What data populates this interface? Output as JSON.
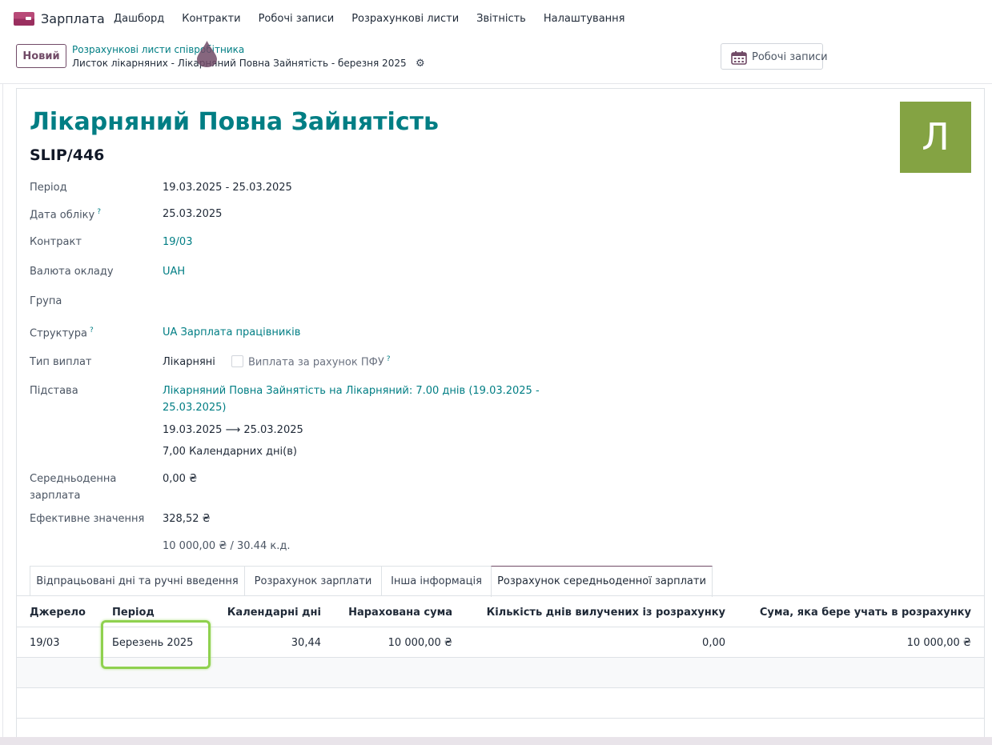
{
  "app": {
    "name": "Зарплата"
  },
  "menu": [
    "Дашборд",
    "Контракти",
    "Робочі записи",
    "Розрахункові листи",
    "Звітність",
    "Налаштування"
  ],
  "control": {
    "new_button": "Новий",
    "breadcrumb_parent": "Розрахункові листи співробітника",
    "breadcrumb_current": "Листок лікарняних - Лікарняний Повна Зайнятість - березня 2025",
    "work_entries_button": "Робочі записи"
  },
  "form": {
    "title": "Лікарняний Повна Зайнятість",
    "reference": "SLIP/446",
    "avatar_letter": "Л",
    "avatar_color": "#84a343",
    "fields": {
      "period_label": "Період",
      "period_value": "19.03.2025 - 25.03.2025",
      "accounting_date_label": "Дата обліку",
      "accounting_date_value": "25.03.2025",
      "contract_label": "Контракт",
      "contract_value": "19/03",
      "currency_label": "Валюта окладу",
      "currency_value": "UAH",
      "group_label": "Група",
      "structure_label": "Структура",
      "structure_value": "UA Зарплата працівників",
      "payment_type_label": "Тип виплат",
      "payment_type_value": "Лікарняні",
      "pfu_checkbox_label": "Виплата за рахунок ПФУ",
      "basis_label": "Підстава",
      "basis_value_line1": "Лікарняний Повна Зайнятість на Лікарняний: 7.00 днів (19.03.2025 -",
      "basis_value_line2": "25.03.2025)",
      "basis_range": "19.03.2025 ⟶ 25.03.2025",
      "basis_days": "7,00 Календарних дні(в)",
      "avg_salary_label_line1": "Середньоденна",
      "avg_salary_label_line2": "зарплата",
      "avg_salary_value": "0,00 ₴",
      "effective_label": "Ефективне значення",
      "effective_value": "328,52 ₴",
      "effective_formula": "10 000,00 ₴ / 30.44 к.д."
    }
  },
  "tabs": [
    "Відпрацьовані дні та ручні введення",
    "Розрахунок зарплати",
    "Інша інформація",
    "Розрахунок середньоденної зарплати"
  ],
  "table": {
    "headers": [
      "Джерело",
      "Період",
      "Календарні дні",
      "Нарахована сума",
      "Кількість днів вилучених із розрахунку",
      "Сума, яка бере учать в розрахунку"
    ],
    "rows": [
      [
        "19/03",
        "Березень 2025",
        "30,44",
        "10 000,00 ₴",
        "0,00",
        "10 000,00 ₴"
      ]
    ]
  },
  "colors": {
    "brand": "#714b67",
    "link": "#017e84",
    "highlight": "#8fd14f"
  }
}
